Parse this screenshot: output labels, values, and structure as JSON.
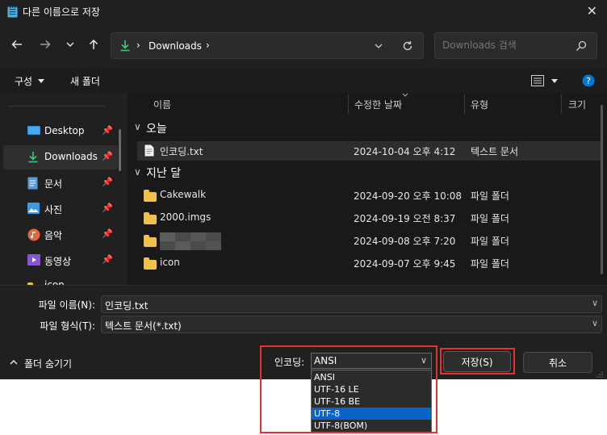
{
  "window": {
    "title": "다른 이름으로 저장"
  },
  "address": {
    "path": "Downloads"
  },
  "search": {
    "placeholder": "Downloads 검색"
  },
  "commands": {
    "organize": "구성",
    "new_folder": "새 폴더"
  },
  "nav": {
    "items": [
      {
        "label": "Desktop"
      },
      {
        "label": "Downloads"
      },
      {
        "label": "문서"
      },
      {
        "label": "사진"
      },
      {
        "label": "음악"
      },
      {
        "label": "동영상"
      },
      {
        "label": "icon"
      }
    ]
  },
  "columns": {
    "name": "이름",
    "modified": "수정한 날짜",
    "type": "유형",
    "size": "크기"
  },
  "groups": {
    "today": "오늘",
    "last_month": "지난 달"
  },
  "files": [
    {
      "name": "인코딩.txt",
      "modified": "2024-10-04 오후 4:12",
      "type": "텍스트 문서"
    },
    {
      "name": "Cakewalk",
      "modified": "2024-09-20 오후 10:08",
      "type": "파일 폴더"
    },
    {
      "name": "2000.imgs",
      "modified": "2024-09-19 오전 8:37",
      "type": "파일 폴더"
    },
    {
      "name": "",
      "modified": "2024-09-08 오후 7:20",
      "type": "파일 폴더"
    },
    {
      "name": "icon",
      "modified": "2024-09-07 오후 9:45",
      "type": "파일 폴더"
    }
  ],
  "form": {
    "filename_label": "파일 이름(N):",
    "filename_value": "인코딩.txt",
    "filetype_label": "파일 형식(T):",
    "filetype_value": "텍스트 문서(*.txt)",
    "hide_folders": "폴더 숨기기",
    "encoding_label": "인코딩:",
    "encoding_value": "ANSI",
    "encoding_options": [
      "ANSI",
      "UTF-16 LE",
      "UTF-16 BE",
      "UTF-8",
      "UTF-8(BOM)"
    ],
    "save": "저장(S)",
    "cancel": "취소"
  },
  "colors": {
    "highlight": "#0a64c8",
    "annotation": "#e8302f",
    "folder": "#f2c14b",
    "accent": "#0078d4"
  }
}
